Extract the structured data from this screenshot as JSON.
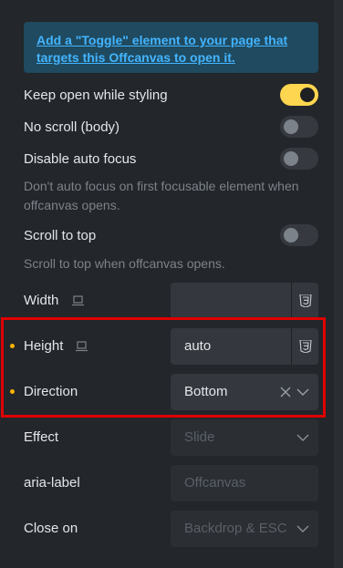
{
  "notice": {
    "text": "Add a \"Toggle\" element to your page that targets this Offcanvas to open it."
  },
  "toggles": [
    {
      "label": "Keep open while styling",
      "on": true
    },
    {
      "label": "No scroll (body)",
      "on": false
    },
    {
      "label": "Disable auto focus",
      "on": false,
      "description": "Don't auto focus on first focusable element when offcanvas opens."
    },
    {
      "label": "Scroll to top",
      "on": false,
      "description": "Scroll to top when offcanvas opens."
    }
  ],
  "fields": {
    "width": {
      "label": "Width",
      "value": "",
      "unit_icon": "css3-icon",
      "responsive_icon": "laptop-icon"
    },
    "height": {
      "label": "Height",
      "value": "auto",
      "unit_icon": "css3-icon",
      "responsive_icon": "laptop-icon"
    },
    "direction": {
      "label": "Direction",
      "value": "Bottom"
    },
    "effect": {
      "label": "Effect",
      "placeholder": "Slide"
    },
    "aria_label": {
      "label": "aria-label",
      "placeholder": "Offcanvas"
    },
    "close_on": {
      "label": "Close on",
      "placeholder": "Backdrop & ESC"
    }
  },
  "colors": {
    "accent": "#ffd64f",
    "link": "#44b4ff",
    "modified_dot": "#ffb300",
    "highlight": "#e00000"
  }
}
